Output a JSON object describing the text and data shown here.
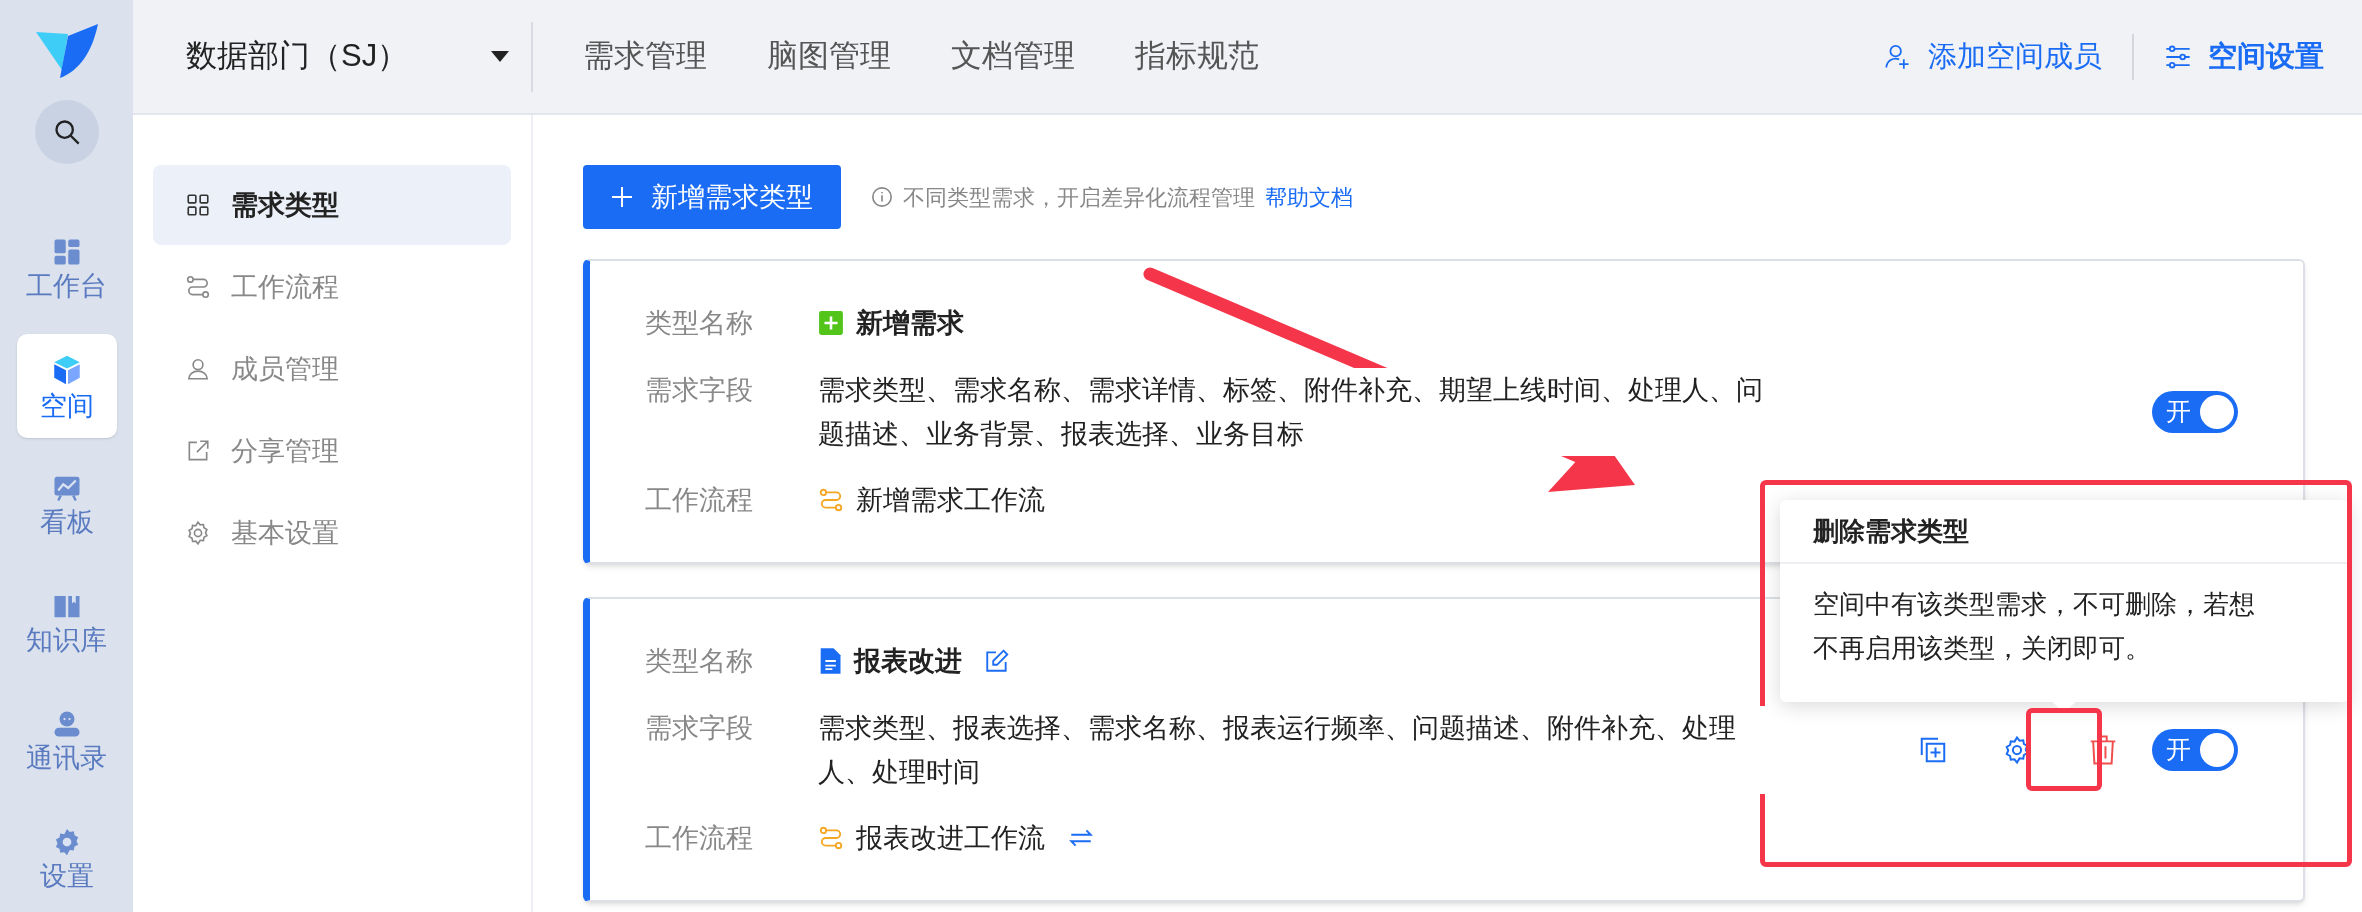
{
  "rail": {
    "items": [
      {
        "label": "工作台",
        "selected": false
      },
      {
        "label": "空间",
        "selected": true
      },
      {
        "label": "看板",
        "selected": false
      },
      {
        "label": "知识库",
        "selected": false
      },
      {
        "label": "通讯录",
        "selected": false
      },
      {
        "label": "设置",
        "selected": false
      }
    ]
  },
  "header": {
    "space_selector": "数据部门（SJ）",
    "nav": [
      {
        "label": "需求管理"
      },
      {
        "label": "脑图管理"
      },
      {
        "label": "文档管理"
      },
      {
        "label": "指标规范"
      }
    ],
    "actions": [
      {
        "label": "添加空间成员",
        "bold": false
      },
      {
        "label": "空间设置",
        "bold": true
      }
    ]
  },
  "sidebar": {
    "items": [
      {
        "label": "需求类型",
        "selected": true
      },
      {
        "label": "工作流程",
        "selected": false
      },
      {
        "label": "成员管理",
        "selected": false
      },
      {
        "label": "分享管理",
        "selected": false
      },
      {
        "label": "基本设置",
        "selected": false
      }
    ]
  },
  "toolbar": {
    "add_button": "新增需求类型",
    "hint": "不同类型需求，开启差异化流程管理",
    "help_link": "帮助文档"
  },
  "cards": [
    {
      "name_label": "类型名称",
      "name": "新增需求",
      "fields_label": "需求字段",
      "fields": "需求类型、需求名称、需求详情、标签、附件补充、期望上线时间、处理人、问题描述、业务背景、报表选择、业务目标",
      "workflow_label": "工作流程",
      "workflow": "新增需求工作流",
      "hovered": false,
      "toggle": {
        "label": "开",
        "on": true
      }
    },
    {
      "name_label": "类型名称",
      "name": "报表改进",
      "fields_label": "需求字段",
      "fields": "需求类型、报表选择、需求名称、报表运行频率、问题描述、附件补充、处理人、处理时间",
      "workflow_label": "工作流程",
      "workflow": "报表改进工作流",
      "hovered": true,
      "toggle": {
        "label": "开",
        "on": true
      }
    }
  ],
  "popover": {
    "title": "删除需求类型",
    "body": "空间中有该类型需求，不可删除，若想不再启用该类型，关闭即可。"
  }
}
